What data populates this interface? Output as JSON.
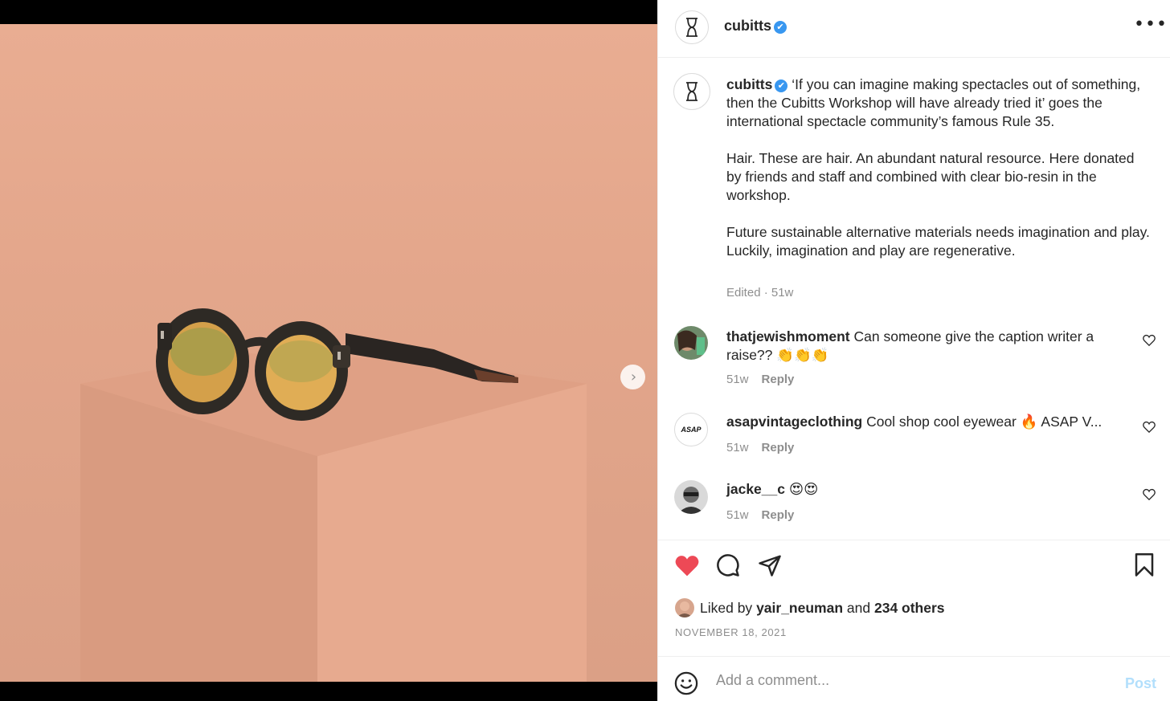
{
  "account": {
    "username": "cubitts",
    "verified_mark": "✔",
    "more_label": "•••"
  },
  "media": {
    "next_label": "›",
    "slides_total": 2,
    "slide_active": 1
  },
  "caption": {
    "username": "cubitts",
    "paragraphs": [
      "‘If you can imagine making spectacles out of something, then the Cubitts Workshop will have already tried it’ goes the international spectacle community’s famous Rule 35.",
      "Hair. These are hair. An abundant natural resource. Here donated by friends and staff and combined with clear bio-resin in the workshop.",
      "Future sustainable alternative materials needs imagination and play. Luckily, imagination and play are regenerative."
    ],
    "meta": "Edited · 51w"
  },
  "comments": [
    {
      "username": "thatjewishmoment",
      "text": "Can someone give the caption writer a raise?? 👏👏👏",
      "age": "51w",
      "reply": "Reply"
    },
    {
      "username": "asapvintageclothing",
      "text": "Cool shop cool eyewear 🔥 ASAP V...",
      "age": "51w",
      "reply": "Reply",
      "avatar_text": "ASAP"
    },
    {
      "username": "jacke__c",
      "text": "😍😍",
      "age": "51w",
      "reply": "Reply"
    }
  ],
  "likes": {
    "prefix": "Liked by",
    "user": "yair_neuman",
    "joiner": "and",
    "others": "234 others"
  },
  "date": "NOVEMBER 18, 2021",
  "compose": {
    "placeholder": "Add a comment...",
    "post_label": "Post"
  },
  "colors": {
    "like_red": "#ed4956",
    "verified_blue": "#3897f0",
    "post_disabled": "#b2dffc",
    "muted": "#8e8e8e",
    "photo_backdrop": "#e3a68b"
  },
  "icons": [
    "hourglass-logo-icon",
    "verified-icon",
    "more-icon",
    "chevron-right-icon",
    "heart-filled-icon",
    "comment-icon",
    "share-icon",
    "bookmark-icon",
    "heart-outline-icon",
    "emoji-icon"
  ]
}
